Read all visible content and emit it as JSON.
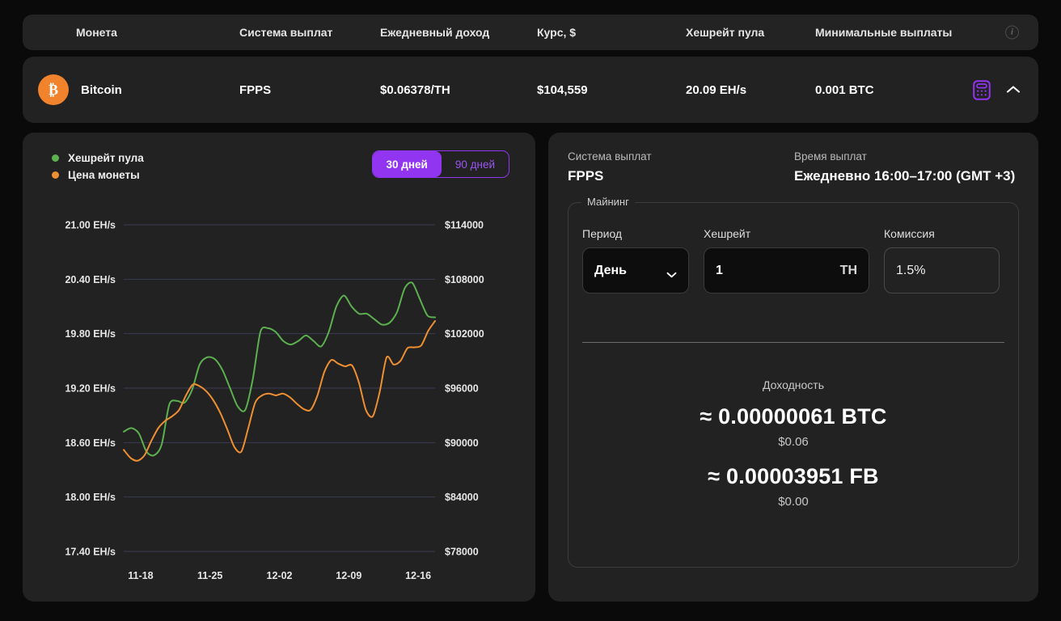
{
  "table": {
    "headers": {
      "coin": "Монета",
      "payout_system": "Система выплат",
      "daily_income": "Ежедневный доход",
      "rate": "Курс, $",
      "pool_hashrate": "Хешрейт пула",
      "min_payouts": "Минимальные выплаты"
    },
    "info_icon": "info-icon",
    "row": {
      "coin_name": "Bitcoin",
      "coin_symbol": "₿",
      "payout_system": "FPPS",
      "daily_income": "$0.06378/TH",
      "rate": "$104,559",
      "pool_hashrate": "20.09 EH/s",
      "min_payouts": "0.001 BTC",
      "calculator_icon": "calculator-icon",
      "collapse_icon": "chevron-up-icon"
    }
  },
  "chart_panel": {
    "legend": [
      {
        "label": "Хешрейт пула",
        "color": "#5cb04f"
      },
      {
        "label": "Цена монеты",
        "color": "#ee8f33"
      }
    ],
    "range_buttons": [
      {
        "label": "30 дней",
        "active": true
      },
      {
        "label": "90 дней",
        "active": false
      }
    ]
  },
  "chart_data": {
    "type": "line",
    "title": "",
    "xlabel": "",
    "grid": true,
    "legend_position": "top-left",
    "x_ticks": [
      "11-18",
      "11-25",
      "12-02",
      "12-09",
      "12-16"
    ],
    "y_left": {
      "label": "Хешрейт пула",
      "unit": "EH/s",
      "ticks": [
        "21.00 EH/s",
        "20.40 EH/s",
        "19.80 EH/s",
        "19.20 EH/s",
        "18.60 EH/s",
        "18.00 EH/s",
        "17.40 EH/s"
      ],
      "values": [
        21.0,
        20.4,
        19.8,
        19.2,
        18.6,
        18.0,
        17.4
      ],
      "ylim": [
        17.4,
        21.0
      ]
    },
    "y_right": {
      "label": "Цена монеты",
      "unit": "$",
      "ticks": [
        "$114000",
        "$108000",
        "$102000",
        "$96000",
        "$90000",
        "$84000",
        "$78000"
      ],
      "values": [
        114000,
        108000,
        102000,
        96000,
        90000,
        84000,
        78000
      ],
      "ylim": [
        78000,
        114000
      ]
    },
    "series": [
      {
        "name": "Хешрейт пула",
        "color": "#5cb04f",
        "axis": "left",
        "unit": "EH/s",
        "values": [
          18.72,
          18.76,
          18.7,
          18.5,
          18.46,
          18.58,
          19.02,
          19.06,
          19.04,
          19.18,
          19.46,
          19.54,
          19.52,
          19.4,
          19.2,
          19.0,
          18.96,
          19.3,
          19.82,
          19.86,
          19.82,
          19.72,
          19.68,
          19.72,
          19.78,
          19.72,
          19.66,
          19.82,
          20.1,
          20.22,
          20.1,
          20.02,
          20.02,
          19.96,
          19.9,
          19.92,
          20.04,
          20.3,
          20.36,
          20.18,
          20.0,
          19.98
        ]
      },
      {
        "name": "Цена монеты",
        "color": "#ee8f33",
        "axis": "right",
        "unit": "$",
        "values": [
          89200,
          88300,
          88000,
          88600,
          90200,
          91600,
          92400,
          92900,
          93600,
          95200,
          96400,
          96200,
          95600,
          94600,
          93200,
          91400,
          89500,
          89000,
          91600,
          94400,
          95200,
          95400,
          95200,
          95400,
          95000,
          94300,
          93700,
          93600,
          95200,
          97800,
          99100,
          98700,
          98400,
          98500,
          96600,
          93600,
          92900,
          95600,
          99400,
          98600,
          99000,
          100400,
          100500,
          100700,
          102300,
          103400
        ]
      }
    ]
  },
  "payout_panel": {
    "payout_system_caption": "Система выплат",
    "payout_system_value": "FPPS",
    "payout_time_caption": "Время выплат",
    "payout_time_value": "Ежедневно 16:00–17:00 (GMT +3)",
    "mining": {
      "legend": "Майнинг",
      "period": {
        "label": "Период",
        "value": "День",
        "chevron_icon": "chevron-down-icon"
      },
      "hashrate": {
        "label": "Хешрейт",
        "value": "1",
        "unit": "TH"
      },
      "fee": {
        "label": "Комиссия",
        "value": "1.5%"
      }
    },
    "result": {
      "caption": "Доходность",
      "primary": "≈ 0.00000061 BTC",
      "primary_fiat": "$0.06",
      "secondary": "≈ 0.00003951 FB",
      "secondary_fiat": "$0.00"
    }
  },
  "colors": {
    "accent_purple": "#9135f0",
    "coin_orange": "#f1832d",
    "hashrate_green": "#5cb04f",
    "price_orange": "#ee8f33",
    "panel_bg": "#222222",
    "page_bg": "#0a0a0a"
  }
}
